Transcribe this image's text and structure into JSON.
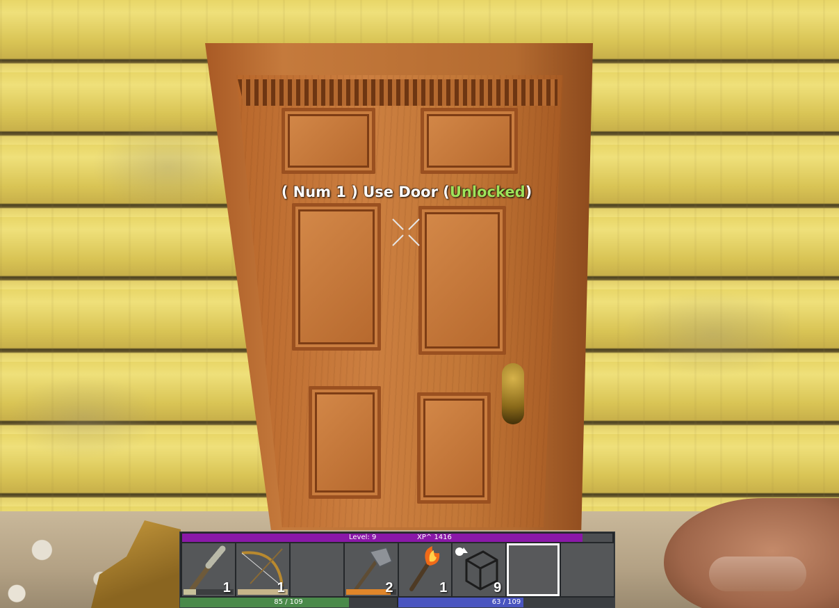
{
  "prompt": {
    "prefix": "( Num 1 ) Use Door (",
    "status": "Unlocked",
    "suffix": ")",
    "status_color": "#9ee35a"
  },
  "hud": {
    "level_label": "Level: 9",
    "xp_label": "XP^ 1416",
    "xp_progress": 0.93,
    "xp_color": "#8a18a8",
    "health": {
      "label": "85 / 109",
      "value": 85,
      "max": 109,
      "color": "#4a8a4a"
    },
    "stamina": {
      "label": "63 / 109",
      "value": 63,
      "max": 109,
      "color": "#4a55c0"
    }
  },
  "toolbelt": {
    "slots": [
      {
        "item": "wooden-club-icon",
        "count": "1",
        "durability": 0.25,
        "durability_color": "#c7c19a"
      },
      {
        "item": "wooden-bow-icon",
        "count": "1",
        "durability": 1.0,
        "durability_color": "#c7b48a"
      },
      {
        "item": "empty",
        "count": "",
        "durability": null
      },
      {
        "item": "stone-axe-icon",
        "count": "2",
        "durability": 0.9,
        "durability_color": "#e0862a"
      },
      {
        "item": "torch-icon",
        "count": "1",
        "durability": null
      },
      {
        "item": "block-shape-icon",
        "count": "9",
        "durability": null
      },
      {
        "item": "empty",
        "count": "",
        "durability": null,
        "selected": true
      },
      {
        "item": "empty",
        "count": "",
        "durability": null
      }
    ]
  }
}
